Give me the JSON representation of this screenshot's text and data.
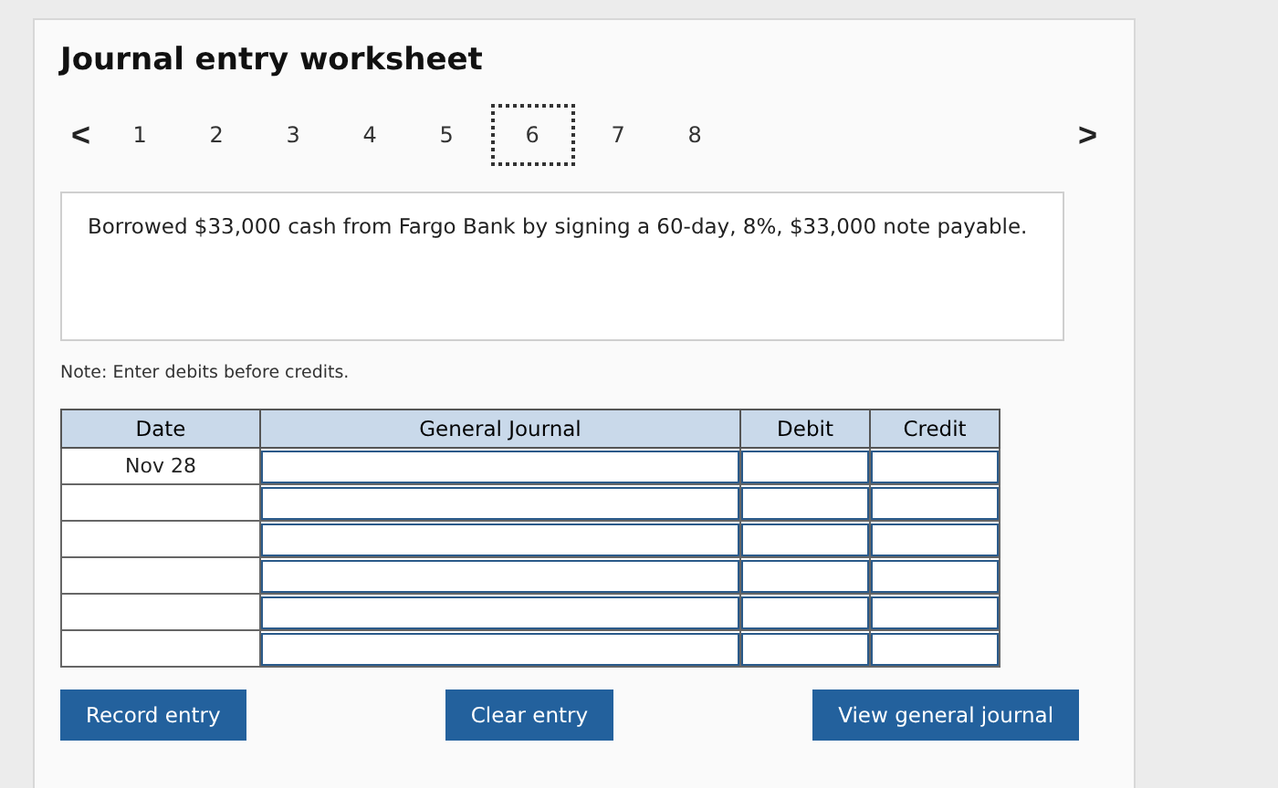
{
  "title": "Journal entry worksheet",
  "pager": {
    "prev": "<",
    "next": ">",
    "pages": [
      {
        "label": "1",
        "selected": false
      },
      {
        "label": "2",
        "selected": false
      },
      {
        "label": "3",
        "selected": false
      },
      {
        "label": "4",
        "selected": false
      },
      {
        "label": "5",
        "selected": false
      },
      {
        "label": "6",
        "selected": true
      },
      {
        "label": "7",
        "selected": false
      },
      {
        "label": "8",
        "selected": false
      }
    ]
  },
  "description": "Borrowed $33,000 cash from Fargo Bank by signing a 60-day, 8%, $33,000 note payable.",
  "note": "Note: Enter debits before credits.",
  "table": {
    "columns": [
      "Date",
      "General Journal",
      "Debit",
      "Credit"
    ],
    "rows": [
      {
        "date": "Nov 28"
      },
      {},
      {},
      {},
      {},
      {}
    ]
  },
  "buttons": [
    "Record entry",
    "Clear entry",
    "View general journal"
  ]
}
